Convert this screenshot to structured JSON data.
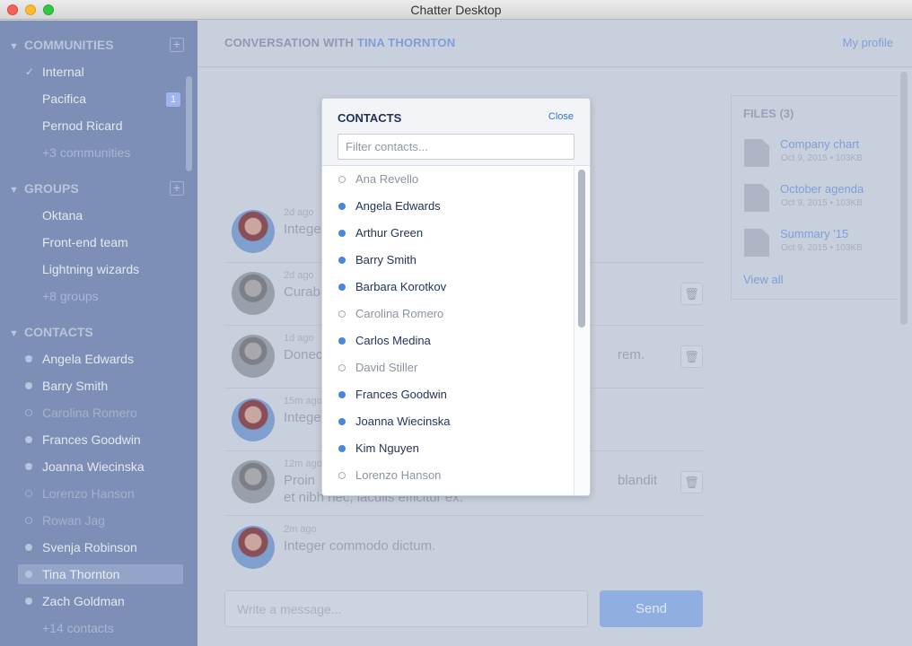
{
  "window": {
    "title": "Chatter Desktop"
  },
  "sidebar": {
    "communities": {
      "heading": "COMMUNITIES",
      "add_label": "+",
      "items": [
        {
          "label": "Internal",
          "checked": true
        },
        {
          "label": "Pacifica",
          "badge": "1"
        },
        {
          "label": "Pernod Ricard"
        }
      ],
      "more": "+3 communities"
    },
    "groups": {
      "heading": "GROUPS",
      "add_label": "+",
      "items": [
        {
          "label": "Oktana"
        },
        {
          "label": "Front-end team"
        },
        {
          "label": "Lightning wizards"
        }
      ],
      "more": "+8 groups"
    },
    "contacts": {
      "heading": "CONTACTS",
      "items": [
        {
          "label": "Angela Edwards",
          "online": true
        },
        {
          "label": "Barry Smith",
          "online": true
        },
        {
          "label": "Carolina Romero",
          "online": false
        },
        {
          "label": "Frances Goodwin",
          "online": true
        },
        {
          "label": "Joanna Wiecinska",
          "online": true
        },
        {
          "label": "Lorenzo Hanson",
          "online": false
        },
        {
          "label": "Rowan Jag",
          "online": false
        },
        {
          "label": "Svenja Robinson",
          "online": true
        },
        {
          "label": "Tina Thornton",
          "online": true,
          "selected": true
        },
        {
          "label": "Zach Goldman",
          "online": true
        }
      ],
      "more": "+14 contacts"
    }
  },
  "header": {
    "title_prefix": "CONVERSATION WITH",
    "title_name": "TINA THORNTON",
    "profile_link": "My profile"
  },
  "messages": [
    {
      "time": "2d ago",
      "text": "Integer",
      "avatar": "female"
    },
    {
      "time": "2d ago",
      "text": "Curab",
      "avatar": "male"
    },
    {
      "time": "1d ago",
      "text": "Donec",
      "tail": "rem.",
      "avatar": "male"
    },
    {
      "time": "15m ago",
      "text": "Intege",
      "avatar": "female"
    },
    {
      "time": "12m ago",
      "text": "Proin",
      "tail": "blandit",
      "line2": "et nibh nec, iaculis efficitur ex.",
      "avatar": "male"
    },
    {
      "time": "2m ago",
      "text": "Integer commodo dictum.",
      "avatar": "female"
    }
  ],
  "composer": {
    "placeholder": "Write a message...",
    "send_label": "Send"
  },
  "files": {
    "title": "FILES (3)",
    "items": [
      {
        "name": "Company chart",
        "meta": "Oct 9, 2015 • 103KB"
      },
      {
        "name": "October agenda",
        "meta": "Oct 9, 2015 • 103KB"
      },
      {
        "name": "Summary '15",
        "meta": "Oct 9, 2015 • 103KB"
      }
    ],
    "view_all": "View all"
  },
  "modal": {
    "title": "CONTACTS",
    "close_label": "Close",
    "filter_placeholder": "Filter contacts...",
    "contacts": [
      {
        "name": "Ana Revello",
        "online": false
      },
      {
        "name": "Angela Edwards",
        "online": true
      },
      {
        "name": "Arthur Green",
        "online": true
      },
      {
        "name": "Barry Smith",
        "online": true
      },
      {
        "name": "Barbara Korotkov",
        "online": true
      },
      {
        "name": "Carolina Romero",
        "online": false
      },
      {
        "name": "Carlos Medina",
        "online": true
      },
      {
        "name": "David Stiller",
        "online": false
      },
      {
        "name": "Frances Goodwin",
        "online": true
      },
      {
        "name": "Joanna Wiecinska",
        "online": true
      },
      {
        "name": "Kim Nguyen",
        "online": true
      },
      {
        "name": "Lorenzo Hanson",
        "online": false
      }
    ]
  },
  "colors": {
    "accent": "#2a75d6",
    "online_dot": "#4a86de",
    "sidebar_bg": "#7d8fb6",
    "overlay_bg": "#c9d0dd"
  }
}
